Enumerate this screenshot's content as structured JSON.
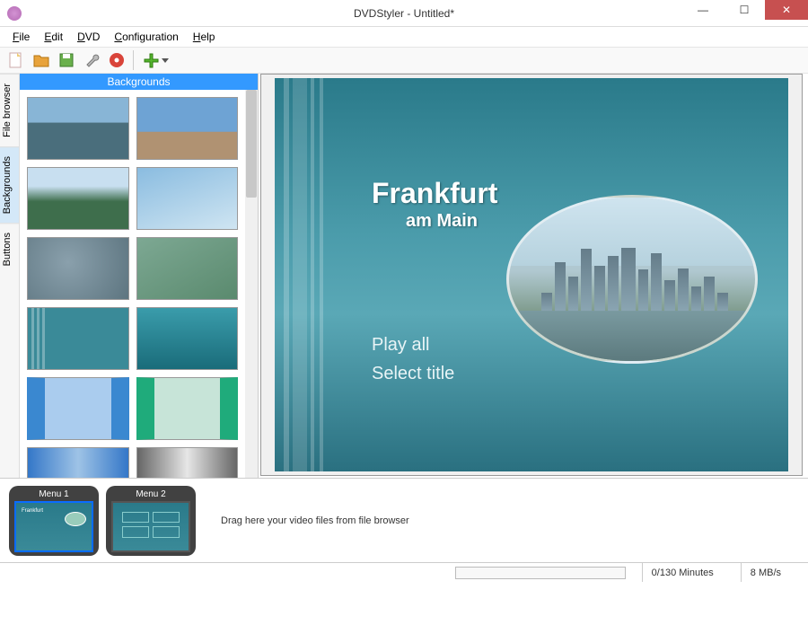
{
  "window": {
    "title": "DVDStyler - Untitled*"
  },
  "menus": {
    "file": "File",
    "edit": "Edit",
    "dvd": "DVD",
    "config": "Configuration",
    "help": "Help"
  },
  "sideTabs": {
    "file_browser": "File browser",
    "backgrounds": "Backgrounds",
    "buttons": "Buttons"
  },
  "panel": {
    "header": "Backgrounds"
  },
  "canvas": {
    "title": "Frankfurt",
    "subtitle": "am Main",
    "play_all": "Play all",
    "select_title": "Select title"
  },
  "timeline": {
    "menu1": "Menu 1",
    "menu2": "Menu 2",
    "hint": "Drag here your video files from file browser"
  },
  "status": {
    "minutes": "0/130 Minutes",
    "bitrate": "8 MB/s"
  },
  "icons": {
    "new": "new-icon",
    "open": "open-icon",
    "save": "save-icon",
    "settings": "settings-icon",
    "burn": "burn-icon",
    "add": "add-icon"
  }
}
